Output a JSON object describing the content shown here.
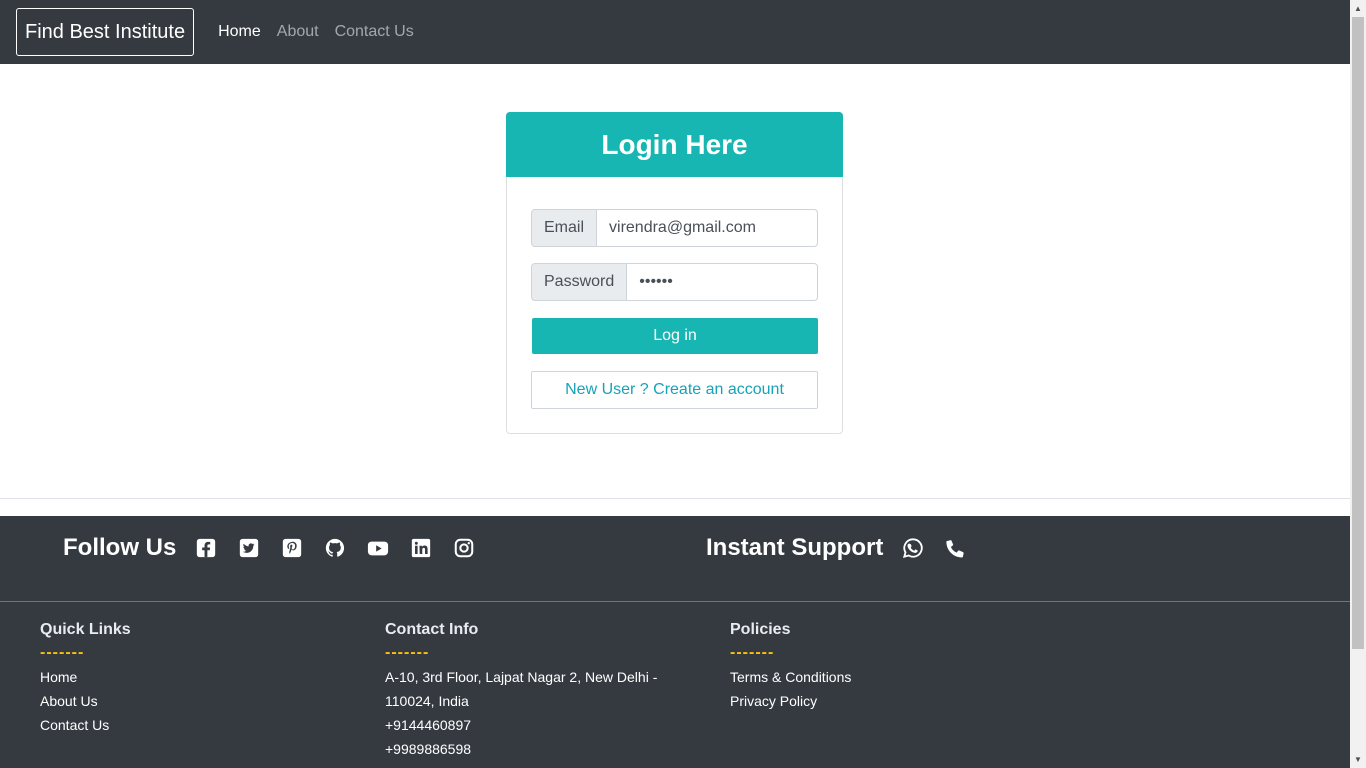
{
  "navbar": {
    "brand": "Find Best Institute",
    "links": [
      {
        "label": "Home",
        "active": true
      },
      {
        "label": "About",
        "active": false
      },
      {
        "label": "Contact Us",
        "active": false
      }
    ]
  },
  "login": {
    "title": "Login Here",
    "email_label": "Email",
    "email_value": "virendra@gmail.com",
    "password_label": "Password",
    "password_value": "••••••",
    "login_button": "Log in",
    "create_account_button": "New User ? Create an account"
  },
  "footer": {
    "follow_title": "Follow Us",
    "social_icons": [
      "facebook-icon",
      "twitter-icon",
      "pinterest-icon",
      "github-icon",
      "youtube-icon",
      "linkedin-icon",
      "instagram-icon"
    ],
    "support_title": "Instant Support",
    "support_icons": [
      "whatsapp-icon",
      "phone-icon"
    ],
    "quick_links": {
      "title": "Quick Links",
      "dash": "-------",
      "items": [
        "Home",
        "About Us",
        "Contact Us"
      ]
    },
    "contact_info": {
      "title": "Contact Info",
      "dash": "-------",
      "address_line1": "A-10, 3rd Floor, Lajpat Nagar 2, New Delhi -",
      "address_line2": "110024, India",
      "phone1": "+9144460897",
      "phone2": "+9989886598"
    },
    "policies": {
      "title": "Policies",
      "dash": "-------",
      "items": [
        "Terms & Conditions",
        "Privacy Policy"
      ]
    }
  },
  "colors": {
    "navbar_bg": "#343a40",
    "accent": "#17b6b2",
    "link": "#17a2b8",
    "dash": "#ffc107"
  }
}
